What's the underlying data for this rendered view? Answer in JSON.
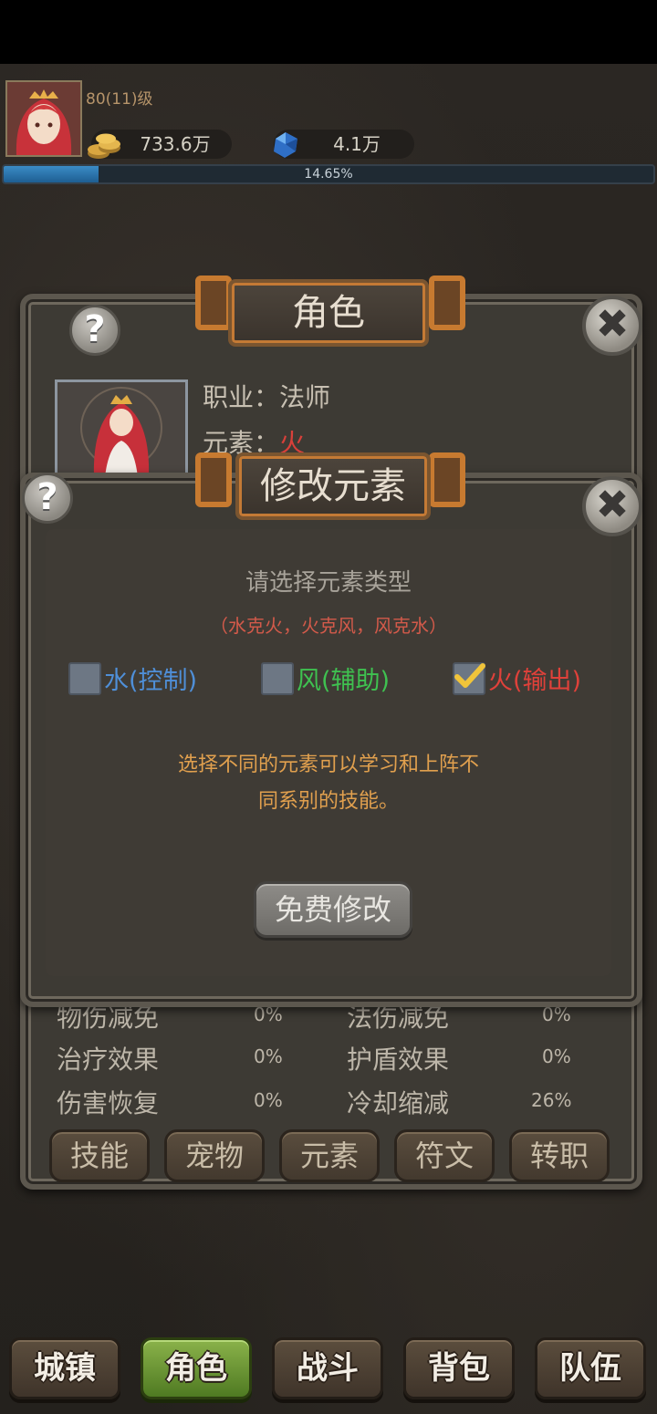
{
  "player": {
    "level_text": "80(11)级",
    "gold": "733.6万",
    "gems": "4.1万",
    "exp_percent_text": "14.65%",
    "exp_fraction": 0.1465
  },
  "role_panel": {
    "title": "角色",
    "job_label": "职业：",
    "job_value": "法师",
    "element_label": "元素：",
    "element_value": "火",
    "stats": [
      {
        "name": "物伤减免",
        "value": "0%"
      },
      {
        "name": "法伤减免",
        "value": "0%"
      },
      {
        "name": "治疗效果",
        "value": "0%"
      },
      {
        "name": "护盾效果",
        "value": "0%"
      },
      {
        "name": "伤害恢复",
        "value": "0%"
      },
      {
        "name": "冷却缩减",
        "value": "26%"
      }
    ],
    "tabs": [
      "技能",
      "宠物",
      "元素",
      "符文",
      "转职"
    ]
  },
  "dialog": {
    "title": "修改元素",
    "prompt": "请选择元素类型",
    "counter_text": "（水克火，火克风，风克水）",
    "options": [
      {
        "label": "水(控制)",
        "checked": false,
        "color": "#4f8fd8"
      },
      {
        "label": "风(辅助)",
        "checked": false,
        "color": "#3fc150"
      },
      {
        "label": "火(输出)",
        "checked": true,
        "color": "#e0413a"
      }
    ],
    "desc_line1": "选择不同的元素可以学习和上阵不",
    "desc_line2": "同系别的技能。",
    "button": "免费修改"
  },
  "nav": {
    "items": [
      "城镇",
      "角色",
      "战斗",
      "背包",
      "队伍"
    ],
    "active_index": 1
  },
  "icons": {
    "help": "?",
    "close": "✖",
    "check": "✔"
  }
}
